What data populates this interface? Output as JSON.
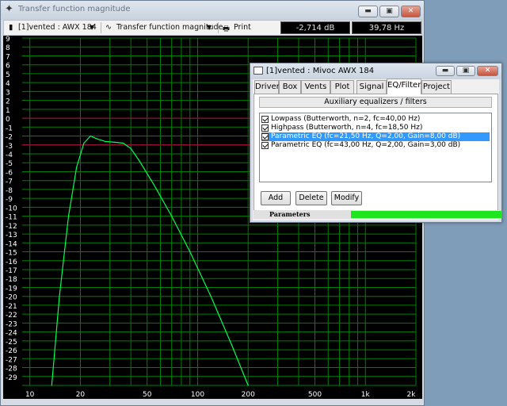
{
  "main_window": {
    "title": "Transfer function magnitude",
    "toolbar": {
      "document_select": "[1]vented : AWX 184",
      "view_select": "Transfer function magnitude",
      "print_label": "Print",
      "readout_db": "-2,714 dB",
      "readout_hz": "39,78 Hz"
    }
  },
  "chart_data": {
    "type": "line",
    "xscale": "log",
    "xlim": [
      9,
      2000
    ],
    "ylim": [
      -30,
      9
    ],
    "x_ticks": [
      "10",
      "20",
      "50",
      "100",
      "200",
      "500",
      "1k",
      "2k"
    ],
    "y_ticks": [
      "9",
      "8",
      "7",
      "6",
      "5",
      "4",
      "3",
      "2",
      "1",
      "0",
      "-1",
      "-2",
      "-3",
      "-4",
      "-5",
      "-6",
      "-7",
      "-8",
      "-9",
      "-10",
      "-11",
      "-12",
      "-13",
      "-14",
      "-15",
      "-16",
      "-17",
      "-18",
      "-19",
      "-20",
      "-21",
      "-22",
      "-23",
      "-24",
      "-25",
      "-26",
      "-27",
      "-28",
      "-29"
    ],
    "grid": true,
    "reference_lines": [
      0,
      -3
    ],
    "series": [
      {
        "color": "#00ff50",
        "x": [
          13.5,
          15,
          17,
          19,
          21,
          23,
          25,
          28,
          32,
          36,
          40,
          45,
          55,
          70,
          90,
          120,
          160,
          200
        ],
        "y": [
          -30,
          -20,
          -11,
          -5.5,
          -2.8,
          -2.0,
          -2.3,
          -2.6,
          -2.7,
          -2.8,
          -3.4,
          -4.8,
          -7.5,
          -11,
          -15,
          -20,
          -25.5,
          -30
        ]
      }
    ],
    "colors": {
      "background": "#000000",
      "grid": "#008000",
      "curve": "#00ff50",
      "reference": "#c00040"
    }
  },
  "dialog": {
    "title": "[1]vented : Mivoc AWX 184",
    "tabs": [
      "Driver",
      "Box",
      "Vents",
      "Plot",
      "Signal",
      "EQ/Filter",
      "Project"
    ],
    "active_tab": "EQ/Filter",
    "aux_header": "Auxiliary equalizers / filters",
    "filters": [
      {
        "label": "Lowpass (Butterworth, n=2, fc=40,00 Hz)",
        "checked": true,
        "selected": false
      },
      {
        "label": "Highpass (Butterworth, n=4, fc=18,50 Hz)",
        "checked": true,
        "selected": false
      },
      {
        "label": "Parametric EQ (fc=21,50 Hz, Q=2,00, Gain=8,00 dB)",
        "checked": true,
        "selected": true
      },
      {
        "label": "Parametric EQ (fc=43,00 Hz, Q=2,00, Gain=3,00 dB)",
        "checked": true,
        "selected": false
      }
    ],
    "buttons": {
      "add": "Add",
      "delete": "Delete",
      "modify": "Modify"
    },
    "status_label": "Parameters",
    "status_progress": 1.0
  }
}
